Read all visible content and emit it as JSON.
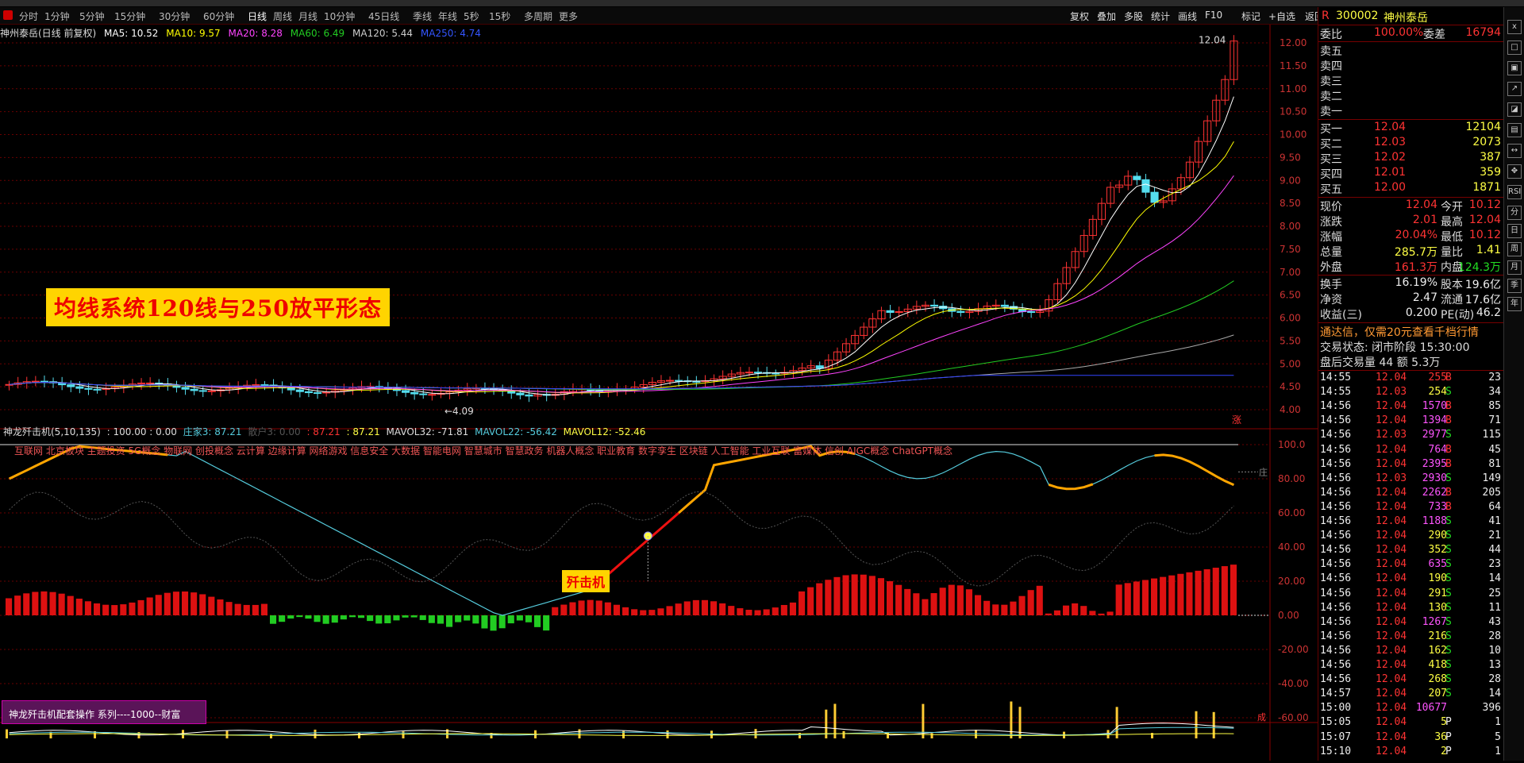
{
  "toolbar": {
    "timeframes": [
      "分时",
      "1分钟",
      "5分钟",
      "15分钟",
      "30分钟",
      "60分钟",
      "日线",
      "周线",
      "月线",
      "10分钟",
      "45日线",
      "季线",
      "年线",
      "5秒",
      "15秒",
      "多周期",
      "更多"
    ],
    "active": "日线",
    "right_buttons": [
      "复权",
      "叠加",
      "多股",
      "统计",
      "画线",
      "F10",
      "标记",
      "+自选",
      "返回"
    ]
  },
  "infobar": {
    "name": "神州泰岳(日线 前复权)",
    "ma5": "MA5: 10.52",
    "ma10": "MA10: 9.57",
    "ma20": "MA20: 8.28",
    "ma60": "MA60: 6.49",
    "ma120": "MA120: 5.44",
    "ma250": "MA250: 4.74"
  },
  "colors": {
    "ma5": "#ffffff",
    "ma10": "#ffff00",
    "ma20": "#ff44ff",
    "ma60": "#22cc22",
    "ma120": "#cccccc",
    "ma250": "#3344ff",
    "up": "#ff3333",
    "down": "#55ddee"
  },
  "banner": "均线系统120线与250放平形态",
  "kline": {
    "high_label": "12.04",
    "low_label": "4.09",
    "yticks": [
      "12.00",
      "11.50",
      "11.00",
      "10.50",
      "10.00",
      "9.50",
      "9.00",
      "8.50",
      "8.00",
      "7.50",
      "7.00",
      "6.50",
      "6.00",
      "5.50",
      "5.00",
      "4.50",
      "4.00"
    ]
  },
  "indicator": {
    "title": "神龙歼击机(5,10,135)",
    "v1": ": 100.00 : 0.00",
    "zhuangjia": "庄家3: 87.21",
    "sanhu": "散户3: 0.00",
    "v87a": ": 87.21",
    "v87b": ": 87.21",
    "mavol32": "MAVOL32: -71.81",
    "mavol22": "MAVOL22: -56.42",
    "mavol12": "MAVOL12: -52.46",
    "concepts": "互联网 北京板块 主题投资 5G概念 物联网 创投概念 云计算 边缘计算 网络游戏 信息安全 大数据 智能电网 智慧城市 智慧政务 机器人概念 职业教育 数字孪生 区块链 人工智能 工业互联 富媒体 信创 AIGC概念 ChatGPT概念",
    "jiji": "歼击机",
    "yticks": [
      "100.0",
      "80.00",
      "60.00",
      "40.00",
      "20.00",
      "0.00",
      "-20.00",
      "-40.00",
      "-60.00"
    ],
    "zhuang_tag": "庄",
    "cheng_tag": "成"
  },
  "purple_box": "神龙歼击机配套操作 系列----1000--财富",
  "zhang_tag": "涨",
  "quote": {
    "code": "300002",
    "name": "神州泰岳",
    "weibi_label": "委比",
    "weibi": "100.00%",
    "weicha_label": "委差",
    "weicha": "16794",
    "sell": [
      {
        "label": "卖五",
        "price": "",
        "vol": ""
      },
      {
        "label": "卖四",
        "price": "",
        "vol": ""
      },
      {
        "label": "卖三",
        "price": "",
        "vol": ""
      },
      {
        "label": "卖二",
        "price": "",
        "vol": ""
      },
      {
        "label": "卖一",
        "price": "",
        "vol": ""
      }
    ],
    "buy": [
      {
        "label": "买一",
        "price": "12.04",
        "vol": "12104"
      },
      {
        "label": "买二",
        "price": "12.03",
        "vol": "2073"
      },
      {
        "label": "买三",
        "price": "12.02",
        "vol": "387"
      },
      {
        "label": "买四",
        "price": "12.01",
        "vol": "359"
      },
      {
        "label": "买五",
        "price": "12.00",
        "vol": "1871"
      }
    ],
    "stats": [
      {
        "l1": "现价",
        "v1": "12.04",
        "l2": "今开",
        "v2": "10.12"
      },
      {
        "l1": "涨跌",
        "v1": "2.01",
        "l2": "最高",
        "v2": "12.04"
      },
      {
        "l1": "涨幅",
        "v1": "20.04%",
        "l2": "最低",
        "v2": "10.12"
      },
      {
        "l1": "总量",
        "v1": "285.7万",
        "l2": "量比",
        "v2": "1.41"
      },
      {
        "l1": "外盘",
        "v1": "161.3万",
        "l2": "内盘",
        "v2": "124.3万"
      }
    ],
    "stats2": [
      {
        "l1": "换手",
        "v1": "16.19%",
        "l2": "股本",
        "v2": "19.6亿"
      },
      {
        "l1": "净资",
        "v1": "2.47",
        "l2": "流通",
        "v2": "17.6亿"
      },
      {
        "l1": "收益(三)",
        "v1": "0.200",
        "l2": "PE(动)",
        "v2": "46.2"
      }
    ],
    "ad": "通达信，仅需20元查看千档行情",
    "status": "交易状态: 闭市阶段 15:30:00",
    "after": "盘后交易量 44 额 5.3万"
  },
  "ticks": [
    [
      "14:55",
      "12.04",
      "255",
      "B",
      "23"
    ],
    [
      "14:55",
      "12.03",
      "254",
      "S",
      "34"
    ],
    [
      "14:56",
      "12.04",
      "1570",
      "B",
      "85"
    ],
    [
      "14:56",
      "12.04",
      "1394",
      "B",
      "71"
    ],
    [
      "14:56",
      "12.03",
      "2977",
      "S",
      "115"
    ],
    [
      "14:56",
      "12.04",
      "764",
      "B",
      "45"
    ],
    [
      "14:56",
      "12.04",
      "2395",
      "B",
      "81"
    ],
    [
      "14:56",
      "12.03",
      "2930",
      "S",
      "149"
    ],
    [
      "14:56",
      "12.04",
      "2262",
      "B",
      "205"
    ],
    [
      "14:56",
      "12.04",
      "733",
      "B",
      "64"
    ],
    [
      "14:56",
      "12.04",
      "1188",
      "S",
      "41"
    ],
    [
      "14:56",
      "12.04",
      "290",
      "S",
      "21"
    ],
    [
      "14:56",
      "12.04",
      "352",
      "S",
      "44"
    ],
    [
      "14:56",
      "12.04",
      "635",
      "S",
      "23"
    ],
    [
      "14:56",
      "12.04",
      "190",
      "S",
      "14"
    ],
    [
      "14:56",
      "12.04",
      "291",
      "S",
      "25"
    ],
    [
      "14:56",
      "12.04",
      "130",
      "S",
      "11"
    ],
    [
      "14:56",
      "12.04",
      "1267",
      "S",
      "43"
    ],
    [
      "14:56",
      "12.04",
      "216",
      "S",
      "28"
    ],
    [
      "14:56",
      "12.04",
      "162",
      "S",
      "10"
    ],
    [
      "14:56",
      "12.04",
      "418",
      "S",
      "13"
    ],
    [
      "14:56",
      "12.04",
      "268",
      "S",
      "28"
    ],
    [
      "14:57",
      "12.04",
      "207",
      "S",
      "14"
    ],
    [
      "15:00",
      "12.04",
      "10677",
      "",
      "396"
    ],
    [
      "15:05",
      "12.04",
      "5",
      "P",
      "1"
    ],
    [
      "15:07",
      "12.04",
      "36",
      "P",
      "5"
    ],
    [
      "15:10",
      "12.04",
      "2",
      "P",
      "1"
    ]
  ],
  "side_icons": [
    "x",
    "□",
    "▣",
    "↗",
    "◪",
    "▤",
    "↔",
    "✥",
    "RSI",
    "分",
    "日",
    "周",
    "月",
    "季",
    "年"
  ]
}
